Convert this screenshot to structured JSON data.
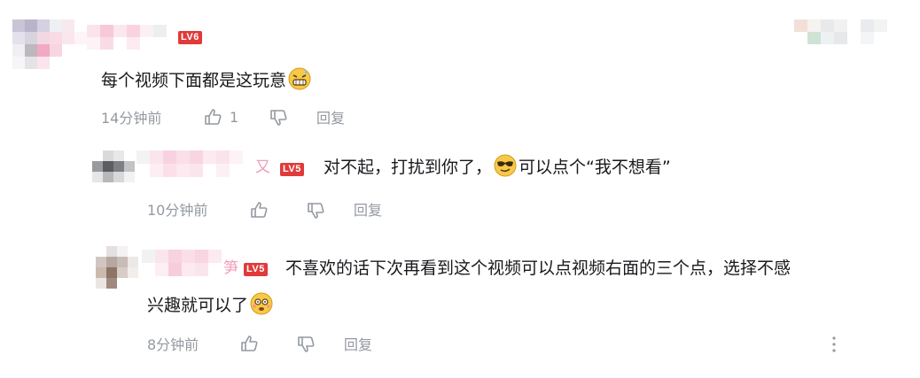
{
  "comment": {
    "level": "LV6",
    "text": "每个视频下面都是这玩意",
    "time": "14分钟前",
    "likes": "1",
    "reply_label": "回复"
  },
  "replies": [
    {
      "level": "LV5",
      "name_tail": "又",
      "text_a": "对不起，打扰到你了，",
      "text_b": "可以点个“我不想看”",
      "time": "10分钟前",
      "reply_label": "回复"
    },
    {
      "level": "LV5",
      "name_tail": "笋",
      "text_line1": "不喜欢的话下次再看到这个视频可以点视频右面的三个点，选择不感",
      "text_line2": "兴趣就可以了",
      "time": "8分钟前",
      "reply_label": "回复"
    }
  ],
  "icons": [
    "thumbs-up-icon",
    "thumbs-down-icon",
    "more-icon"
  ],
  "colors": {
    "level_badge": "#e03a3a",
    "meta_text": "#9499a0",
    "body_text": "#18191c"
  }
}
